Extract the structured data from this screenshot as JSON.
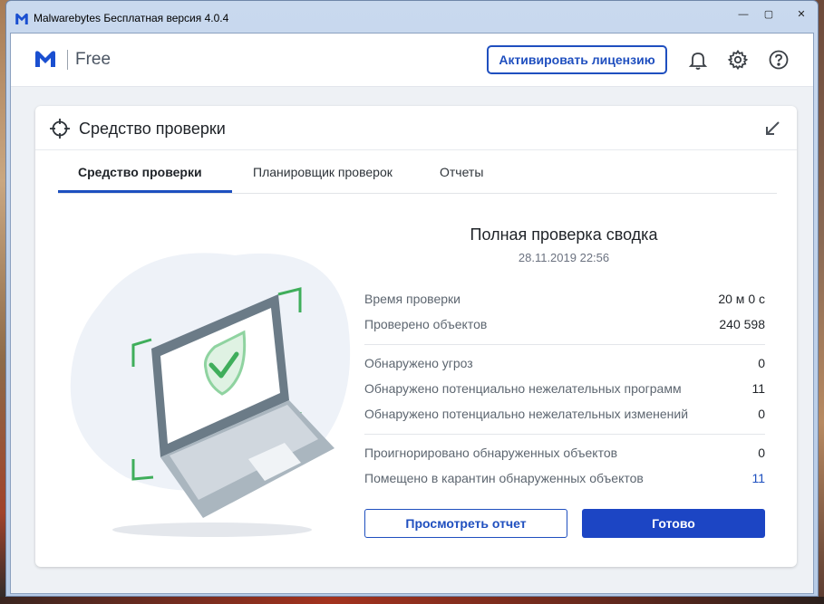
{
  "window": {
    "title": "Malwarebytes Бесплатная версия  4.0.4",
    "controls": {
      "minimize": "—",
      "maximize": "▢",
      "close": "✕"
    }
  },
  "header": {
    "brand": "Free",
    "activate_label": "Активировать лицензию",
    "icons": [
      "bell-icon",
      "gear-icon",
      "help-icon"
    ]
  },
  "card": {
    "title": "Средство проверки",
    "tabs": [
      {
        "label": "Средство проверки",
        "active": true
      },
      {
        "label": "Планировщик проверок",
        "active": false
      },
      {
        "label": "Отчеты",
        "active": false
      }
    ]
  },
  "summary": {
    "title": "Полная проверка сводка",
    "date": "28.11.2019 22:56",
    "rows": [
      {
        "label": "Время проверки",
        "value": "20 м 0 с"
      },
      {
        "label": "Проверено объектов",
        "value": "240 598"
      },
      {
        "label": "Обнаружено угроз",
        "value": "0"
      },
      {
        "label": "Обнаружено потенциально нежелательных программ",
        "value": "11"
      },
      {
        "label": "Обнаружено потенциально нежелательных изменений",
        "value": "0"
      },
      {
        "label": "Проигнорировано обнаруженных объектов",
        "value": "0"
      },
      {
        "label": "Помещено в карантин обнаруженных объектов",
        "value": "11"
      }
    ]
  },
  "buttons": {
    "view_report": "Просмотреть отчет",
    "done": "Готово"
  },
  "colors": {
    "accent": "#1d4fbf",
    "primary_button": "#1c45c4",
    "shield_green": "#4bb46b"
  }
}
